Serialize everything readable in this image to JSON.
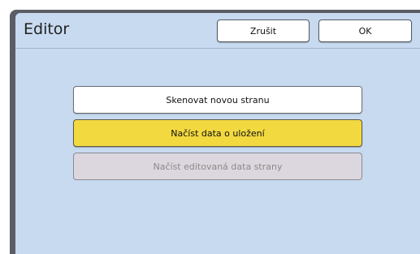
{
  "dialog": {
    "title": "Editor",
    "cancel_label": "Zrušit",
    "ok_label": "OK"
  },
  "options": {
    "scan_label": "Skenovat novou stranu",
    "load_saved_label": "Načíst data o uložení",
    "load_edited_label": "Načíst editovaná data strany"
  },
  "state": {
    "selected_option": "Načíst data o uložení",
    "disabled_option": "Načíst editovaná data strany"
  },
  "colors": {
    "background": "#c8daf0",
    "selected": "#f2d940",
    "disabled": "#dcd7de"
  }
}
